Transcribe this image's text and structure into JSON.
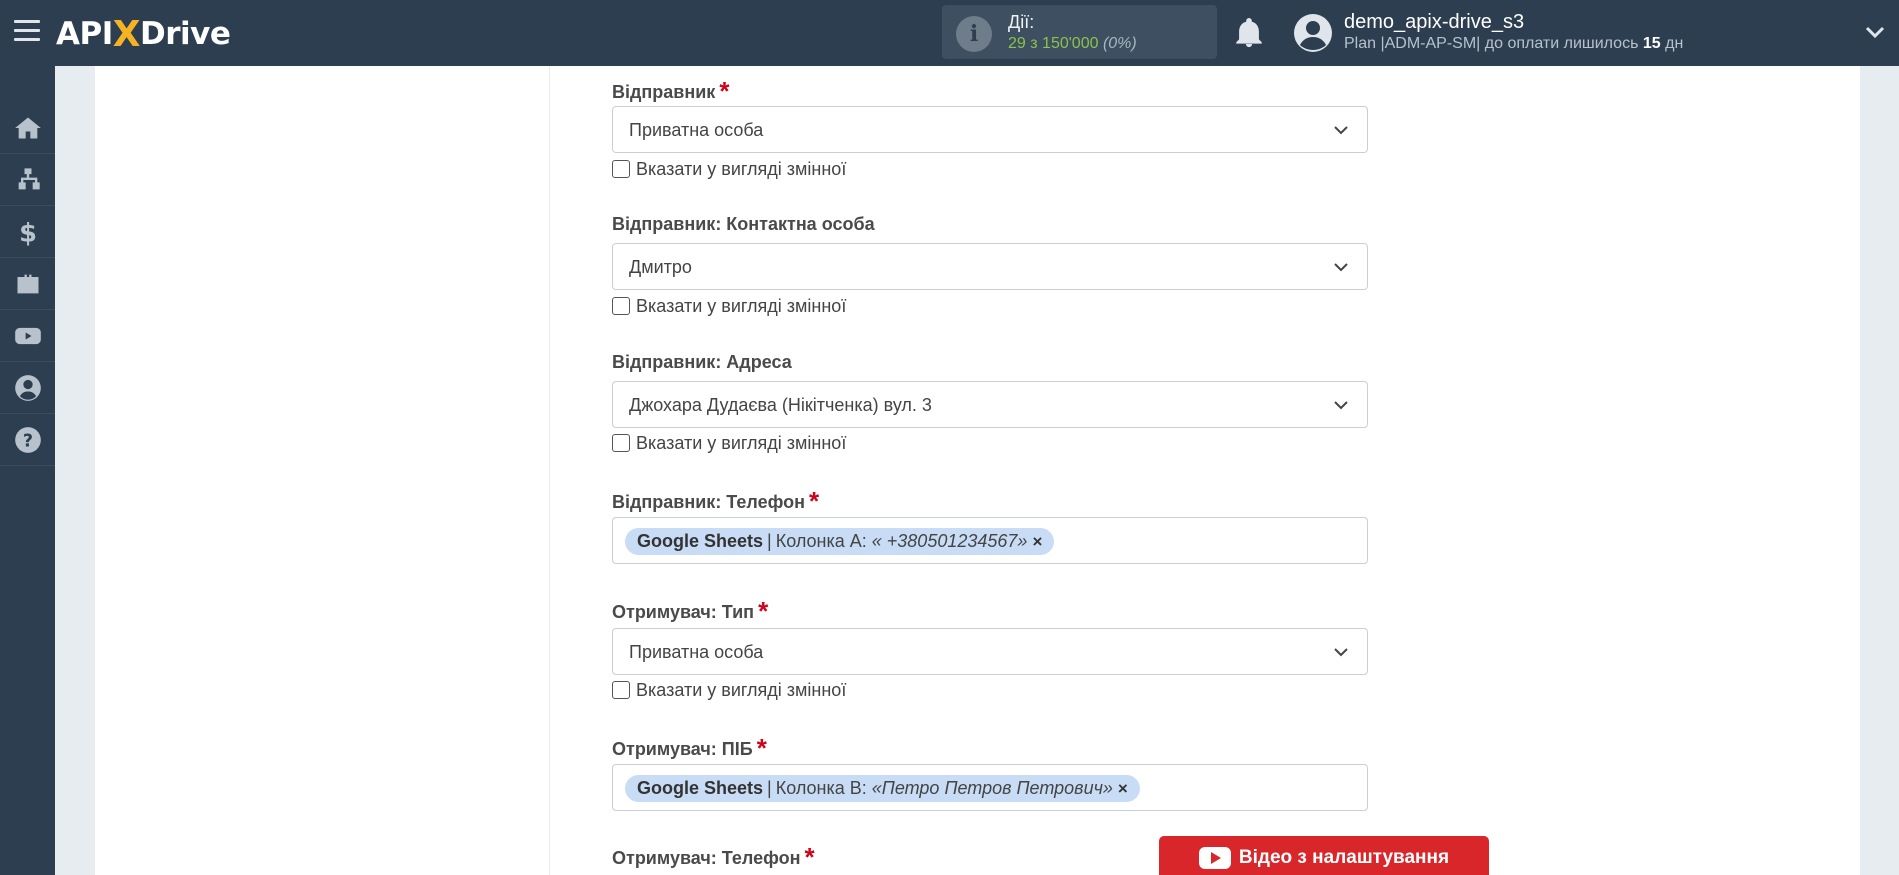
{
  "header": {
    "logo": {
      "part1": "API",
      "part2": "X",
      "part3": "Drive"
    },
    "actions": {
      "label": "Дії:",
      "used": "29",
      "separator": "з",
      "total": "150'000",
      "percent": "(0%)"
    },
    "user": {
      "name": "demo_apix-drive_s3",
      "plan_prefix": "Plan |ADM-AP-SM| до оплати лишилось",
      "days": "15",
      "days_unit": "дн"
    }
  },
  "sidebar": {
    "items": [
      {
        "icon": "home-icon"
      },
      {
        "icon": "sitemap-icon"
      },
      {
        "icon": "dollar-icon"
      },
      {
        "icon": "briefcase-icon"
      },
      {
        "icon": "youtube-icon"
      },
      {
        "icon": "user-circle-icon"
      },
      {
        "icon": "question-circle-icon"
      }
    ]
  },
  "form": {
    "checkbox_label": "Вказати у вигляді змінної",
    "sender": {
      "label": "Відправник",
      "required_mark": "*",
      "value": "Приватна особа"
    },
    "sender_contact": {
      "label": "Відправник: Контактна особа",
      "value": "Дмитро"
    },
    "sender_address": {
      "label": "Відправник: Адреса",
      "value": "Джохара Дудаєва (Нікітченка) вул. 3"
    },
    "sender_phone": {
      "label": "Відправник: Телефон",
      "required_mark": "*",
      "tag": {
        "source": "Google Sheets",
        "sep": "|",
        "column": "Колонка A:",
        "example": "« +380501234567»",
        "remove": "×"
      }
    },
    "recipient_type": {
      "label": "Отримувач: Тип",
      "required_mark": "*",
      "value": "Приватна особа"
    },
    "recipient_name": {
      "label": "Отримувач: ПІБ",
      "required_mark": "*",
      "tag": {
        "source": "Google Sheets",
        "sep": "|",
        "column": "Колонка B:",
        "example": "«Петро Петров Петрович»",
        "remove": "×"
      }
    },
    "recipient_phone": {
      "label": "Отримувач: Телефон",
      "required_mark": "*"
    }
  },
  "video_button": {
    "label": "Відео з налаштування"
  }
}
